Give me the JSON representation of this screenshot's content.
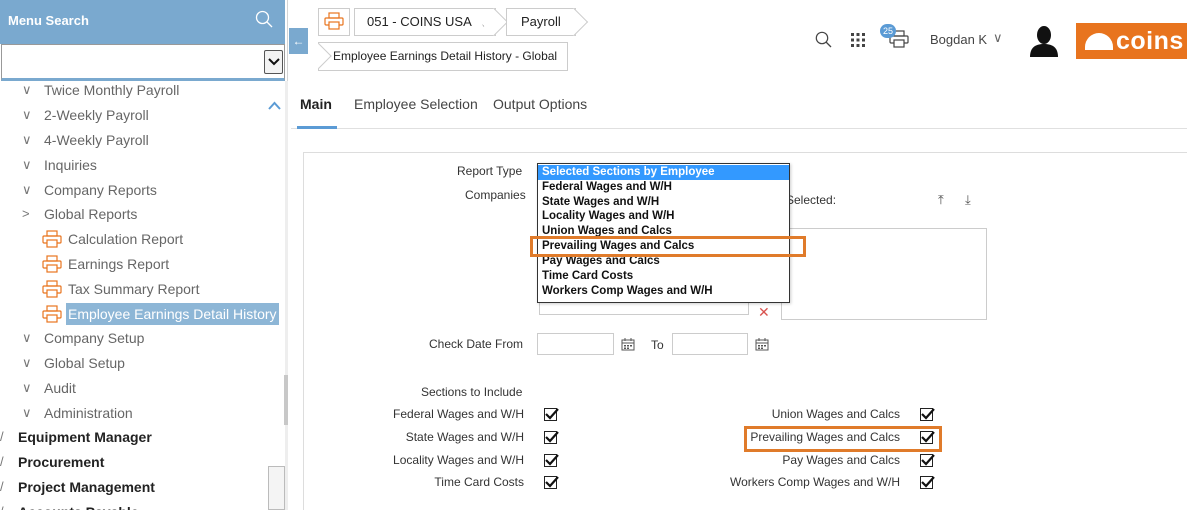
{
  "sidebar": {
    "menu_search_label": "Menu Search",
    "items": [
      {
        "label": "Twice Monthly Payroll",
        "chev": "∨"
      },
      {
        "label": "2-Weekly Payroll",
        "chev": "∨"
      },
      {
        "label": "4-Weekly Payroll",
        "chev": "∨"
      },
      {
        "label": "Inquiries",
        "chev": "∨"
      },
      {
        "label": "Company Reports",
        "chev": "∨"
      },
      {
        "label": "Global Reports",
        "chev": ">"
      },
      {
        "label": "Calculation Report"
      },
      {
        "label": "Earnings Report"
      },
      {
        "label": "Tax Summary Report"
      },
      {
        "label": "Employee Earnings Detail History"
      },
      {
        "label": "Company Setup",
        "chev": "∨"
      },
      {
        "label": "Global Setup",
        "chev": "∨"
      },
      {
        "label": "Audit",
        "chev": "∨"
      },
      {
        "label": "Administration",
        "chev": "∨"
      },
      {
        "label": "Equipment Manager",
        "chev": "/"
      },
      {
        "label": "Procurement",
        "chev": "/"
      },
      {
        "label": "Project Management",
        "chev": "/"
      },
      {
        "label": "Accounts Payable",
        "chev": "/"
      }
    ]
  },
  "header": {
    "company": "051 - COINS USA",
    "company_chev": "↓",
    "module": "Payroll",
    "page": "Employee Earnings Detail History - Global",
    "badge": "25",
    "user": "Bogdan K",
    "user_chev": "∨",
    "logo_text": "coins",
    "collapse_arrow": "←"
  },
  "tabs": [
    "Main",
    "Employee Selection",
    "Output Options"
  ],
  "form": {
    "report_type_label": "Report Type",
    "companies_label": "Companies",
    "selected_label": "Selected:",
    "check_date_from_label": "Check Date From",
    "to_label": "To",
    "check_date_from": "",
    "check_date_to": "",
    "sections_label": "Sections to Include",
    "remove_icon": "✕",
    "move_up": "⤒",
    "move_down": "⤓"
  },
  "report_type_options": [
    "Selected Sections by Employee",
    "Federal Wages and W/H",
    "State Wages and W/H",
    "Locality Wages and W/H",
    "Union Wages and Calcs",
    "Prevailing Wages and Calcs",
    "Pay Wages and Calcs",
    "Time Card Costs",
    "Workers Comp Wages and W/H"
  ],
  "report_type_selected_index": 0,
  "sections_left": [
    {
      "label": "Federal Wages and W/H",
      "checked": true
    },
    {
      "label": "State Wages and W/H",
      "checked": true
    },
    {
      "label": "Locality Wages and W/H",
      "checked": true
    },
    {
      "label": "Time Card Costs",
      "checked": true
    }
  ],
  "sections_right": [
    {
      "label": "Union Wages and Calcs",
      "checked": true
    },
    {
      "label": "Prevailing Wages and Calcs",
      "checked": true
    },
    {
      "label": "Pay Wages and Calcs",
      "checked": true
    },
    {
      "label": "Workers Comp Wages and W/H",
      "checked": true
    }
  ],
  "colors": {
    "accent": "#5b9bd5",
    "sidebar_header": "#7aa9cf",
    "highlight": "#e07b2a",
    "brand": "#e8741e",
    "selection": "#3399ff"
  }
}
